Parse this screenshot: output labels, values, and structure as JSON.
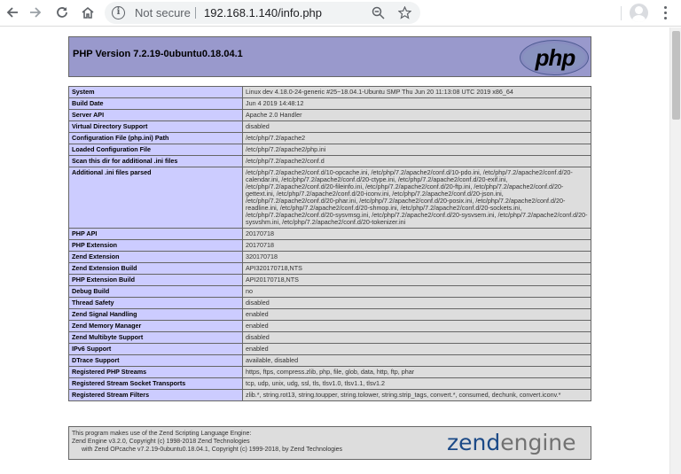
{
  "browser": {
    "security_label": "Not secure",
    "url": "192.168.1.140/info.php",
    "icons": [
      "back-arrow-icon",
      "forward-arrow-icon",
      "reload-icon",
      "home-icon",
      "info-icon",
      "zoom-icon",
      "star-icon",
      "profile-icon",
      "menu-icon"
    ]
  },
  "header": {
    "title": "PHP Version 7.2.19-0ubuntu0.18.04.1",
    "logo_text": "php"
  },
  "colors": {
    "header_bg": "#9999cc",
    "key_bg": "#ccccff",
    "value_bg": "#dddddd",
    "border": "#666666",
    "zend_blue": "#1c4a87"
  },
  "rows": [
    {
      "key": "System",
      "value": "Linux dev 4.18.0-24-generic #25~18.04.1-Ubuntu SMP Thu Jun 20 11:13:08 UTC 2019 x86_64"
    },
    {
      "key": "Build Date",
      "value": "Jun 4 2019 14:48:12"
    },
    {
      "key": "Server API",
      "value": "Apache 2.0 Handler"
    },
    {
      "key": "Virtual Directory Support",
      "value": "disabled"
    },
    {
      "key": "Configuration File (php.ini) Path",
      "value": "/etc/php/7.2/apache2"
    },
    {
      "key": "Loaded Configuration File",
      "value": "/etc/php/7.2/apache2/php.ini"
    },
    {
      "key": "Scan this dir for additional .ini files",
      "value": "/etc/php/7.2/apache2/conf.d"
    },
    {
      "key": "Additional .ini files parsed",
      "value": "/etc/php/7.2/apache2/conf.d/10-opcache.ini, /etc/php/7.2/apache2/conf.d/10-pdo.ini, /etc/php/7.2/apache2/conf.d/20-calendar.ini, /etc/php/7.2/apache2/conf.d/20-ctype.ini, /etc/php/7.2/apache2/conf.d/20-exif.ini, /etc/php/7.2/apache2/conf.d/20-fileinfo.ini, /etc/php/7.2/apache2/conf.d/20-ftp.ini, /etc/php/7.2/apache2/conf.d/20-gettext.ini, /etc/php/7.2/apache2/conf.d/20-iconv.ini, /etc/php/7.2/apache2/conf.d/20-json.ini, /etc/php/7.2/apache2/conf.d/20-phar.ini, /etc/php/7.2/apache2/conf.d/20-posix.ini, /etc/php/7.2/apache2/conf.d/20-readline.ini, /etc/php/7.2/apache2/conf.d/20-shmop.ini, /etc/php/7.2/apache2/conf.d/20-sockets.ini, /etc/php/7.2/apache2/conf.d/20-sysvmsg.ini, /etc/php/7.2/apache2/conf.d/20-sysvsem.ini, /etc/php/7.2/apache2/conf.d/20-sysvshm.ini, /etc/php/7.2/apache2/conf.d/20-tokenizer.ini"
    },
    {
      "key": "PHP API",
      "value": "20170718"
    },
    {
      "key": "PHP Extension",
      "value": "20170718"
    },
    {
      "key": "Zend Extension",
      "value": "320170718"
    },
    {
      "key": "Zend Extension Build",
      "value": "API320170718,NTS"
    },
    {
      "key": "PHP Extension Build",
      "value": "API20170718,NTS"
    },
    {
      "key": "Debug Build",
      "value": "no"
    },
    {
      "key": "Thread Safety",
      "value": "disabled"
    },
    {
      "key": "Zend Signal Handling",
      "value": "enabled"
    },
    {
      "key": "Zend Memory Manager",
      "value": "enabled"
    },
    {
      "key": "Zend Multibyte Support",
      "value": "disabled"
    },
    {
      "key": "IPv6 Support",
      "value": "enabled"
    },
    {
      "key": "DTrace Support",
      "value": "available, disabled"
    },
    {
      "key": "Registered PHP Streams",
      "value": "https, ftps, compress.zlib, php, file, glob, data, http, ftp, phar"
    },
    {
      "key": "Registered Stream Socket Transports",
      "value": "tcp, udp, unix, udg, ssl, tls, tlsv1.0, tlsv1.1, tlsv1.2"
    },
    {
      "key": "Registered Stream Filters",
      "value": "zlib.*, string.rot13, string.toupper, string.tolower, string.strip_tags, convert.*, consumed, dechunk, convert.iconv.*"
    }
  ],
  "footer": {
    "lines": [
      "This program makes use of the Zend Scripting Language Engine:",
      "Zend Engine v3.2.0, Copyright (c) 1998-2018 Zend Technologies",
      "with Zend OPcache v7.2.19-0ubuntu0.18.04.1, Copyright (c) 1999-2018, by Zend Technologies"
    ],
    "logo_word1": "zend",
    "logo_word2": "engine"
  }
}
